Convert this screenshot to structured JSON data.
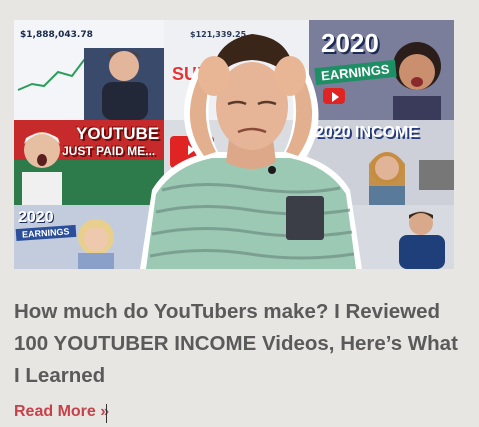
{
  "thumbnail": {
    "chart_amount": "$1,888,043.78",
    "mid_amount": "$121,339.25",
    "tile_top_right": {
      "year": "2020",
      "banner": "EARNINGS"
    },
    "tile_left": {
      "line1": "YOUTUBE",
      "line2": "JUST PAID ME..."
    },
    "tile_right": {
      "text": "2020 INCOME"
    },
    "tile_bottom_left": {
      "year": "2020",
      "banner": "EARNINGS"
    },
    "mid_text": "SURF",
    "colors": {
      "youtube_red": "#e02424",
      "earnings_green": "#1e8f64",
      "shirt_mint": "#9cc9b3"
    }
  },
  "post": {
    "title": "How much do YouTubers make? I Reviewed 100 YOUTUBER INCOME Videos, Here’s What I Learned",
    "read_more": "Read More »"
  }
}
